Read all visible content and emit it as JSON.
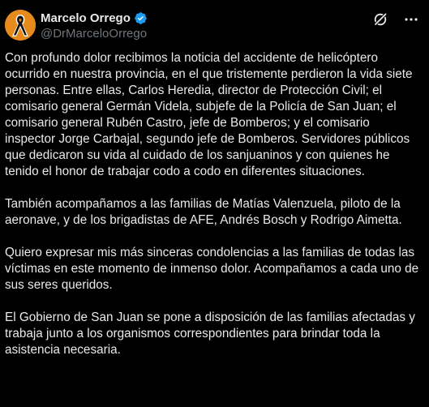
{
  "author": {
    "display_name": "Marcelo Orrego",
    "handle": "@DrMarceloOrrego",
    "verified": true
  },
  "icons": {
    "avatar": "mourning-ribbon-avatar",
    "verified": "verified-badge-icon",
    "grok": "grok-icon",
    "more": "more-icon"
  },
  "colors": {
    "background": "#000000",
    "text": "#e7e9ea",
    "secondary_text": "#71767b",
    "verified_blue": "#1d9bf0",
    "avatar_bg": "#e68a1c"
  },
  "post": {
    "paragraphs": [
      "Con profundo dolor recibimos la noticia del accidente de helicóptero ocurrido en nuestra provincia, en el que tristemente perdieron la vida siete personas. Entre ellas, Carlos Heredia, director de Protección Civil; el comisario general Germán Videla, subjefe de la Policía de San Juan; el comisario general Rubén Castro, jefe de Bomberos; y el comisario inspector Jorge Carbajal, segundo jefe de Bomberos. Servidores públicos que dedicaron su vida al cuidado de los sanjuaninos y con quienes he tenido el honor de trabajar codo a codo en diferentes situaciones.",
      "También acompañamos a las familias de Matías Valenzuela, piloto de la aeronave, y de los brigadistas de AFE, Andrés Bosch y Rodrigo Aimetta.",
      "Quiero expresar mis más sinceras condolencias a las familias de todas las víctimas en este momento de inmenso dolor. Acompañamos a cada uno de sus seres queridos.",
      "El Gobierno de San Juan se pone a disposición de las familias afectadas y trabaja junto a los organismos correspondientes para brindar toda la asistencia necesaria."
    ]
  }
}
